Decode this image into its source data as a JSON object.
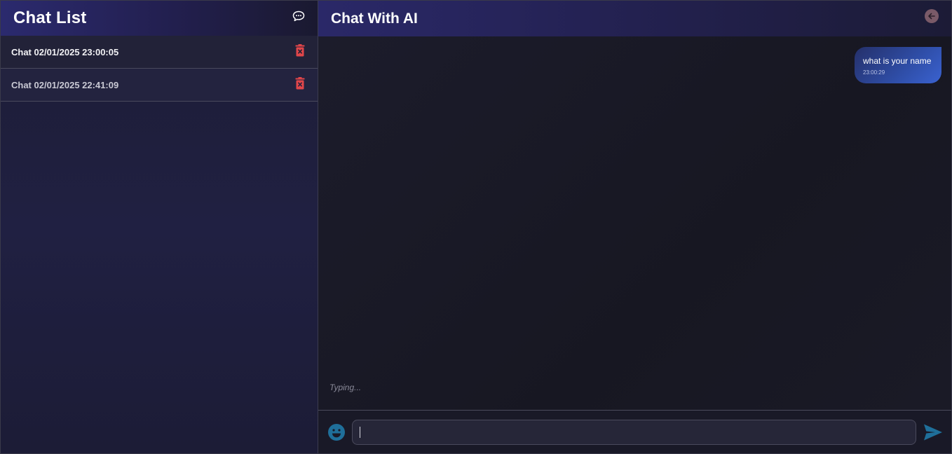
{
  "sidebar": {
    "title": "Chat List",
    "items": [
      {
        "label": "Chat 02/01/2025 23:00:05"
      },
      {
        "label": "Chat 02/01/2025 22:41:09"
      }
    ]
  },
  "main": {
    "title": "Chat With AI",
    "messages": [
      {
        "text": "what is your name",
        "time": "23:00:29"
      }
    ],
    "typing": "Typing...",
    "input_value": ""
  },
  "icons": {
    "new_chat": "chat-bubble-icon",
    "delete": "trash-icon",
    "back": "arrow-left-icon",
    "emoji": "smiley-icon",
    "send": "send-icon"
  },
  "colors": {
    "delete": "#e0464a",
    "bubble": "#2f4ea8",
    "accent_icon": "#1f6f9a"
  }
}
